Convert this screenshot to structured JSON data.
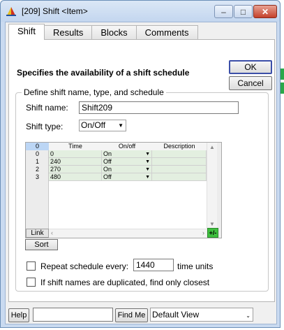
{
  "window": {
    "title": "[209] Shift <Item>",
    "minimize": "–",
    "maximize": "□",
    "close": "✕"
  },
  "tabs": [
    {
      "label": "Shift"
    },
    {
      "label": "Results"
    },
    {
      "label": "Blocks"
    },
    {
      "label": "Comments"
    }
  ],
  "panel": {
    "heading": "Specifies the availability of a shift schedule",
    "ok_label": "OK",
    "cancel_label": "Cancel",
    "group_title": "Define shift name, type, and schedule",
    "shift_name_label": "Shift name:",
    "shift_name_value": "Shift209",
    "shift_type_label": "Shift type:",
    "shift_type_value": "On/Off"
  },
  "table": {
    "corner": "0",
    "columns": [
      "Time",
      "On/off",
      "Description"
    ],
    "rows": [
      {
        "num": "0",
        "time": "0",
        "state": "On",
        "desc": ""
      },
      {
        "num": "1",
        "time": "240",
        "state": "Off",
        "desc": ""
      },
      {
        "num": "2",
        "time": "270",
        "state": "On",
        "desc": ""
      },
      {
        "num": "3",
        "time": "480",
        "state": "Off",
        "desc": ""
      }
    ],
    "link_label": "Link",
    "plusminus_label": "+/-",
    "sort_label": "Sort"
  },
  "options": {
    "repeat_label": "Repeat schedule every:",
    "repeat_value": "1440",
    "repeat_units": "time units",
    "duplicate_label": "If shift names are duplicated, find only closest"
  },
  "footer": {
    "help_label": "Help",
    "find_input_value": "",
    "find_me_label": "Find Me",
    "view_value": "Default View"
  },
  "colors": {
    "accent_green": "#3fbf3f",
    "cell_fill": "#e3efe0",
    "title_bar": "#c9daf0"
  }
}
